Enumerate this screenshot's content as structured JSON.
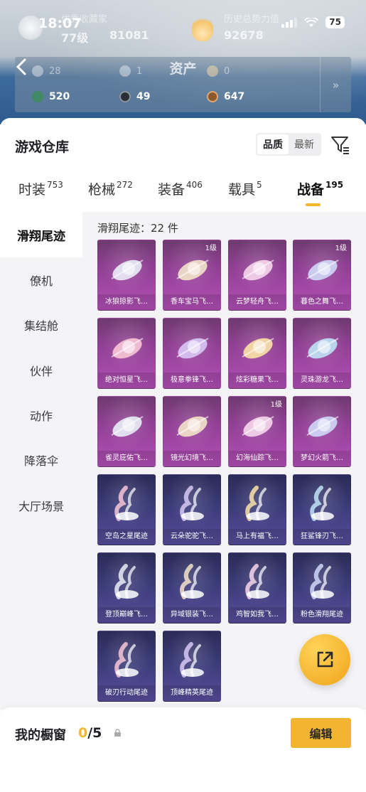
{
  "status_bar": {
    "time": "18:07",
    "battery": "75"
  },
  "profile": {
    "title_left": "优秀收藏家",
    "level": "77级",
    "score": "81081",
    "title_right": "历史总势力值",
    "power": "92678"
  },
  "assets": {
    "title": "资产",
    "row1": [
      "28",
      "1",
      "0"
    ],
    "row2": [
      "520",
      "49",
      "647"
    ],
    "expand_label": "»"
  },
  "warehouse": {
    "title": "游戏仓库",
    "sort": {
      "quality": "品质",
      "latest": "最新"
    },
    "filter_icon": "filter-icon"
  },
  "tabs": [
    {
      "label": "时装",
      "count": "753"
    },
    {
      "label": "枪械",
      "count": "272"
    },
    {
      "label": "装备",
      "count": "406"
    },
    {
      "label": "载具",
      "count": "5"
    },
    {
      "label": "战备",
      "count": "195"
    }
  ],
  "active_tab": "战备",
  "sidebar": [
    {
      "label": "滑翔尾迹"
    },
    {
      "label": "僚机"
    },
    {
      "label": "集结舱"
    },
    {
      "label": "伙伴"
    },
    {
      "label": "动作"
    },
    {
      "label": "降落伞"
    },
    {
      "label": "大厅场景"
    }
  ],
  "grid": {
    "count_label": "滑翔尾迹：22 件",
    "items": [
      {
        "name": "冰狼掠影飞…",
        "level": "",
        "rarity": "purple"
      },
      {
        "name": "香车宝马飞…",
        "level": "1级",
        "rarity": "purple"
      },
      {
        "name": "云梦轻舟飞…",
        "level": "",
        "rarity": "purple"
      },
      {
        "name": "暮色之舞飞…",
        "level": "1级",
        "rarity": "purple"
      },
      {
        "name": "绝对恒星飞…",
        "level": "",
        "rarity": "purple"
      },
      {
        "name": "极意拳锋飞…",
        "level": "",
        "rarity": "purple"
      },
      {
        "name": "炫彩糖果飞…",
        "level": "",
        "rarity": "purple"
      },
      {
        "name": "灵珠游龙飞…",
        "level": "",
        "rarity": "purple"
      },
      {
        "name": "雀灵庇佑飞…",
        "level": "",
        "rarity": "purple"
      },
      {
        "name": "镜光幻境飞…",
        "level": "",
        "rarity": "purple"
      },
      {
        "name": "幻海仙踪飞…",
        "level": "1级",
        "rarity": "purple"
      },
      {
        "name": "梦幻火箭飞…",
        "level": "",
        "rarity": "purple"
      },
      {
        "name": "空岛之星尾迹",
        "level": "",
        "rarity": "blue"
      },
      {
        "name": "云朵驼驼飞…",
        "level": "",
        "rarity": "blue"
      },
      {
        "name": "马上有福飞…",
        "level": "",
        "rarity": "blue"
      },
      {
        "name": "狂鲨锋刃飞…",
        "level": "",
        "rarity": "blue"
      },
      {
        "name": "登顶巅峰飞…",
        "level": "",
        "rarity": "blue"
      },
      {
        "name": "异域银装飞…",
        "level": "",
        "rarity": "blue"
      },
      {
        "name": "鸡智如我飞…",
        "level": "",
        "rarity": "blue"
      },
      {
        "name": "粉色滑翔尾迹",
        "level": "",
        "rarity": "blue"
      },
      {
        "name": "破刃行动尾迹",
        "level": "",
        "rarity": "blue"
      },
      {
        "name": "顶峰精英尾迹",
        "level": "",
        "rarity": "blue"
      }
    ]
  },
  "showcase": {
    "label": "我的橱窗",
    "current": "0",
    "total": "/5",
    "edit_label": "编辑"
  },
  "colors": {
    "accent": "#f2b630",
    "purple_card": "#8e3f91",
    "blue_card": "#3b3b78"
  }
}
